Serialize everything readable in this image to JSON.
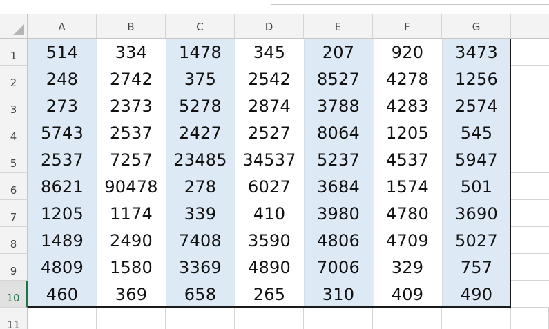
{
  "columns": [
    "A",
    "B",
    "C",
    "D",
    "E",
    "F",
    "G"
  ],
  "rows": [
    "1",
    "2",
    "3",
    "4",
    "5",
    "6",
    "7",
    "8",
    "9",
    "10",
    "11"
  ],
  "active_row": "10",
  "shaded_color": "#dde9f5",
  "header_active_color": "#217346",
  "cells": [
    [
      "514",
      "334",
      "1478",
      "345",
      "207",
      "920",
      "3473"
    ],
    [
      "248",
      "2742",
      "375",
      "2542",
      "8527",
      "4278",
      "1256"
    ],
    [
      "273",
      "2373",
      "5278",
      "2874",
      "3788",
      "4283",
      "2574"
    ],
    [
      "5743",
      "2537",
      "2427",
      "2527",
      "8064",
      "1205",
      "545"
    ],
    [
      "2537",
      "7257",
      "23485",
      "34537",
      "5237",
      "4537",
      "5947"
    ],
    [
      "8621",
      "90478",
      "278",
      "6027",
      "3684",
      "1574",
      "501"
    ],
    [
      "1205",
      "1174",
      "339",
      "410",
      "3980",
      "4780",
      "3690"
    ],
    [
      "1489",
      "2490",
      "7408",
      "3590",
      "4806",
      "4709",
      "5027"
    ],
    [
      "4809",
      "1580",
      "3369",
      "4890",
      "7006",
      "329",
      "757"
    ],
    [
      "460",
      "369",
      "658",
      "265",
      "310",
      "409",
      "490"
    ]
  ]
}
